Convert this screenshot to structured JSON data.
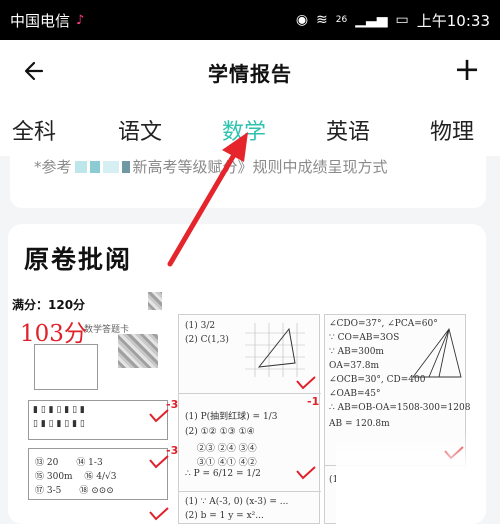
{
  "status_bar": {
    "carrier": "中国电信",
    "signal_label": "26",
    "time": "上午10:33"
  },
  "header": {
    "title": "学情报告",
    "back_icon": "arrow-left-icon",
    "add_label": "+"
  },
  "tabs": [
    {
      "label": "全科",
      "active": false
    },
    {
      "label": "语文",
      "active": false
    },
    {
      "label": "数学",
      "active": true
    },
    {
      "label": "英语",
      "active": false
    },
    {
      "label": "物理",
      "active": false
    }
  ],
  "info": {
    "prefix": "*参考",
    "middle": "新高考等级赋分》规则中成绩呈现方式"
  },
  "paper": {
    "title": "原卷批阅",
    "full_score": "满分：120分",
    "score": "103分",
    "minus_marks": [
      "-3",
      "-3",
      "-1"
    ]
  },
  "colors": {
    "accent": "#2ec2b0",
    "mark_red": "#e0202a"
  }
}
